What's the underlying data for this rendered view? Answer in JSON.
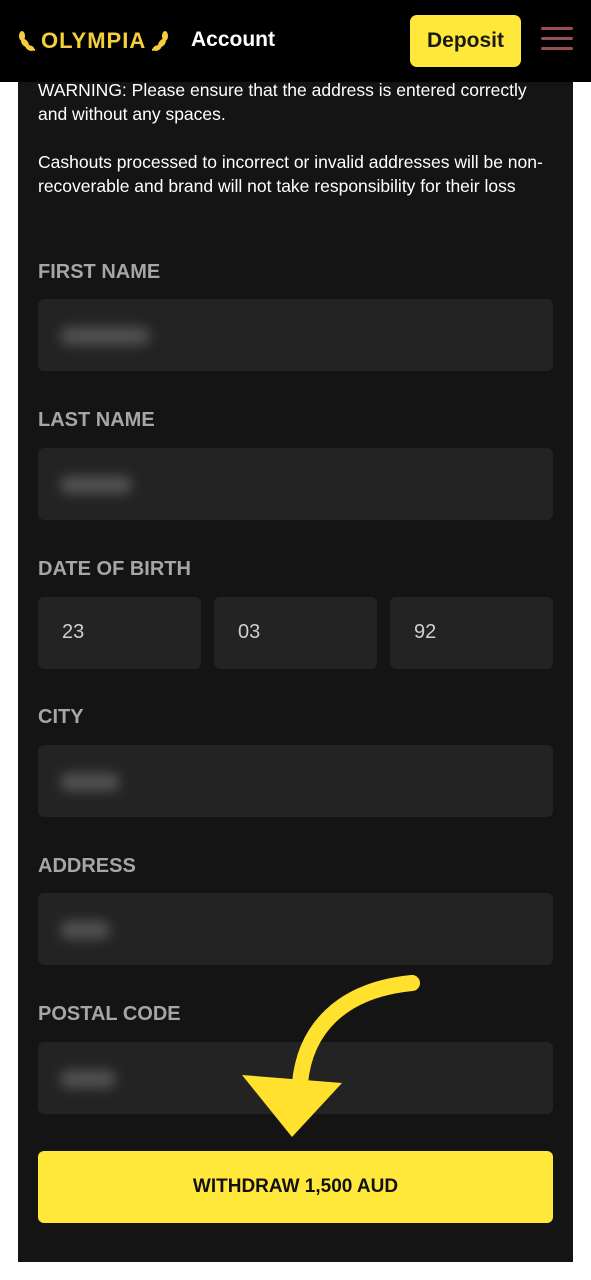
{
  "header": {
    "logo_text": "OLYMPIA",
    "title": "Account",
    "deposit_label": "Deposit",
    "menu_icon": "hamburger-menu-icon"
  },
  "warning": {
    "line1": "WARNING: Please ensure that the address is entered correctly and without any spaces.",
    "line2": "Cashouts processed to incorrect or invalid addresses will be non-recoverable and brand will not take responsibility for their loss"
  },
  "form": {
    "first_name_label": "FIRST NAME",
    "last_name_label": "LAST NAME",
    "dob_label": "DATE OF BIRTH",
    "dob_day": "23",
    "dob_month": "03",
    "dob_year": "92",
    "city_label": "CITY",
    "address_label": "ADDRESS",
    "postal_code_label": "POSTAL CODE"
  },
  "withdraw_label": "WITHDRAW 1,500 AUD",
  "colors": {
    "accent": "#ffe83a",
    "background": "#141414",
    "field": "#232323"
  }
}
